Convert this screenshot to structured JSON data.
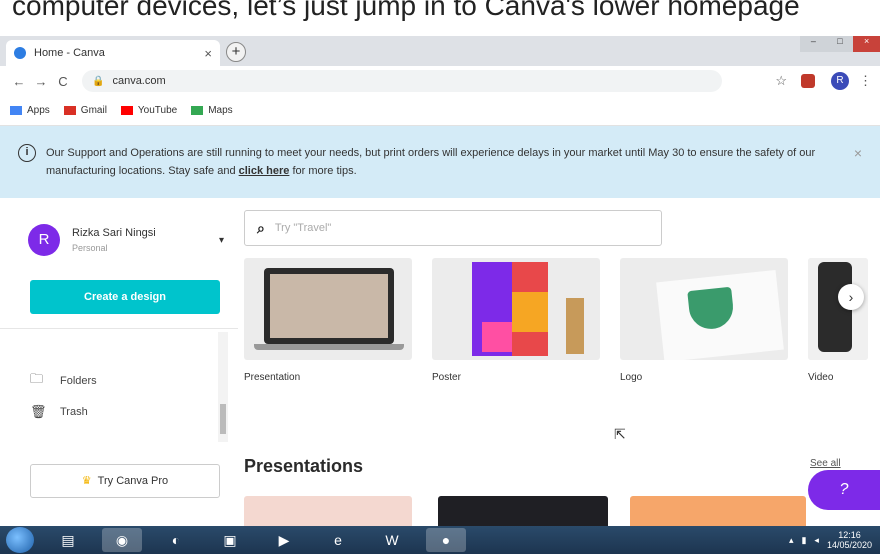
{
  "caption_fragment": "computer devices, let’s just jump in to Canva's lower homepage",
  "browser": {
    "tab_title": "Home - Canva",
    "tab_close": "×",
    "new_tab": "+",
    "url": "canva.com",
    "profile_initial": "R",
    "bookmarks": [
      {
        "label": "Apps",
        "color": "#4285f4"
      },
      {
        "label": "Gmail",
        "color": "#d93025"
      },
      {
        "label": "YouTube",
        "color": "#ff0000"
      },
      {
        "label": "Maps",
        "color": "#34a853"
      }
    ],
    "window_controls": [
      "–",
      "□",
      "×"
    ]
  },
  "banner": {
    "text": "Our Support and Operations are still running to meet your needs, but print orders will experience delays in your market until May 30 to ensure the safety of our manufacturing locations. Stay safe and ",
    "link": "click here",
    "text_end": " for more tips.",
    "close": "×"
  },
  "sidebar": {
    "avatar_initial": "R",
    "user_name": "Rizka Sari Ningsi",
    "user_plan": "Personal",
    "create_button": "Create a design",
    "items": [
      {
        "label": "Folders",
        "icon": "folder-icon"
      },
      {
        "label": "Trash",
        "icon": "trash-icon"
      }
    ],
    "try_pro": "Try Canva Pro"
  },
  "main": {
    "search_placeholder": "Try \"Travel\"",
    "design_types": [
      {
        "label": "Presentation"
      },
      {
        "label": "Poster"
      },
      {
        "label": "Logo"
      },
      {
        "label": "Video"
      }
    ],
    "section_title": "Presentations",
    "see_all": "See all",
    "help_label": "?"
  },
  "taskbar": {
    "time": "12:16",
    "date": "14/05/2020"
  },
  "colors": {
    "accent": "#00c4cc",
    "brand_purple": "#7d2ae8",
    "banner_bg": "#d4ebf7"
  }
}
